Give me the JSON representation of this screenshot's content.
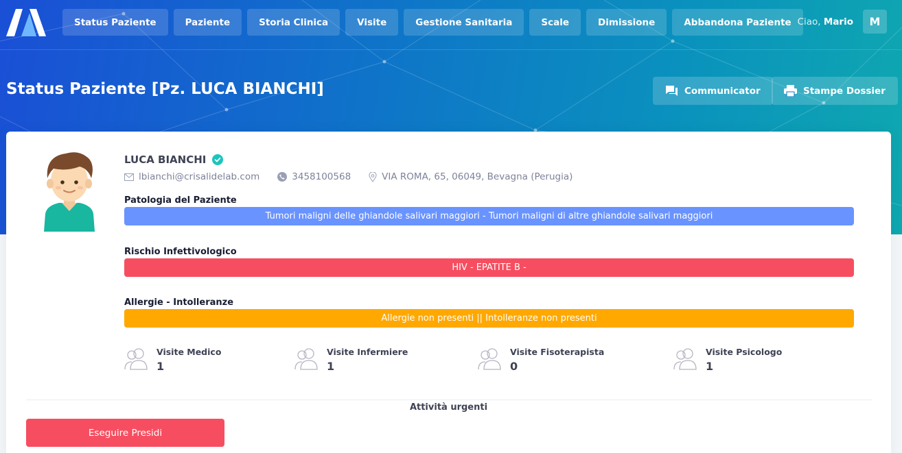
{
  "nav": {
    "items": [
      {
        "label": "Status Paziente"
      },
      {
        "label": "Paziente"
      },
      {
        "label": "Storia Clinica"
      },
      {
        "label": "Visite"
      },
      {
        "label": "Gestione Sanitaria"
      },
      {
        "label": "Scale"
      },
      {
        "label": "Dimissione"
      },
      {
        "label": "Abbandona Paziente"
      }
    ]
  },
  "user": {
    "greeting": "Ciao,",
    "name": "Mario",
    "initial": "M"
  },
  "page": {
    "title": "Status Paziente [Pz. LUCA BIANCHI]",
    "communicator_label": "Communicator",
    "print_label": "Stampe Dossier"
  },
  "patient": {
    "name": "LUCA BIANCHI",
    "email": "lbianchi@crisalidelab.com",
    "phone": "3458100568",
    "address": "VIA ROMA, 65, 06049, Bevagna (Perugia)"
  },
  "sections": {
    "pathology": {
      "label": "Patologia del Paziente",
      "value": "Tumori maligni delle ghiandole salivari maggiori - Tumori maligni di altre ghiandole salivari maggiori",
      "color": "#6993ff"
    },
    "infection": {
      "label": "Rischio Infettivologico",
      "value": "HIV - EPATITE B -",
      "color": "#f64e60"
    },
    "allergies": {
      "label": "Allergie - Intolleranze",
      "value": "Allergie non presenti || Intolleranze non presenti",
      "color": "#ffa800"
    }
  },
  "stats": [
    {
      "label": "Visite Medico",
      "value": "1"
    },
    {
      "label": "Visite Infermiere",
      "value": "1"
    },
    {
      "label": "Visite Fisoterapista",
      "value": "0"
    },
    {
      "label": "Visite Psicologo",
      "value": "1"
    }
  ],
  "urgent": {
    "title": "Attività urgenti",
    "button_label": "Eseguire Presidi"
  }
}
